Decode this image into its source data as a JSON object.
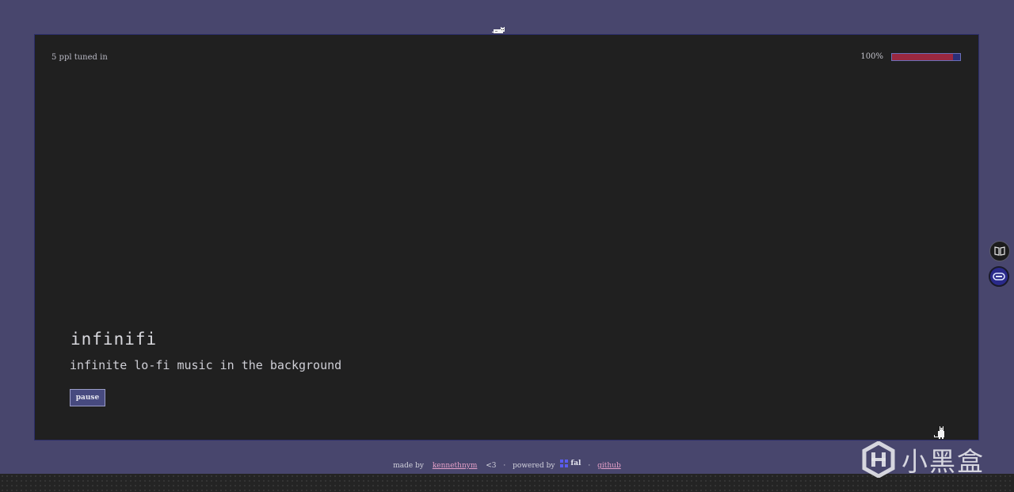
{
  "player": {
    "listeners": "5 ppl tuned in",
    "volume_label": "100%",
    "volume_level": 0.9,
    "title": "infinifi",
    "subtitle": "infinite lo-fi music in the background",
    "pause_label": "pause"
  },
  "footer": {
    "made_by": "made by",
    "author": "kennethnym",
    "heart": "<3",
    "sep1": "·",
    "powered_by": "powered by",
    "provider": "fal",
    "sep2": "·",
    "github": "github"
  },
  "watermark": {
    "text": "小黑盒"
  },
  "colors": {
    "background": "#48466d",
    "panel": "#202020",
    "volume_fill": "#9a2840",
    "button": "#474a7f",
    "link": "#e4a0c8"
  },
  "icons": {
    "top_cat": "cat-sleeping-icon",
    "bottom_cat": "cat-sitting-icon",
    "side_top": "book-icon",
    "side_bottom": "gamepad-icon"
  }
}
